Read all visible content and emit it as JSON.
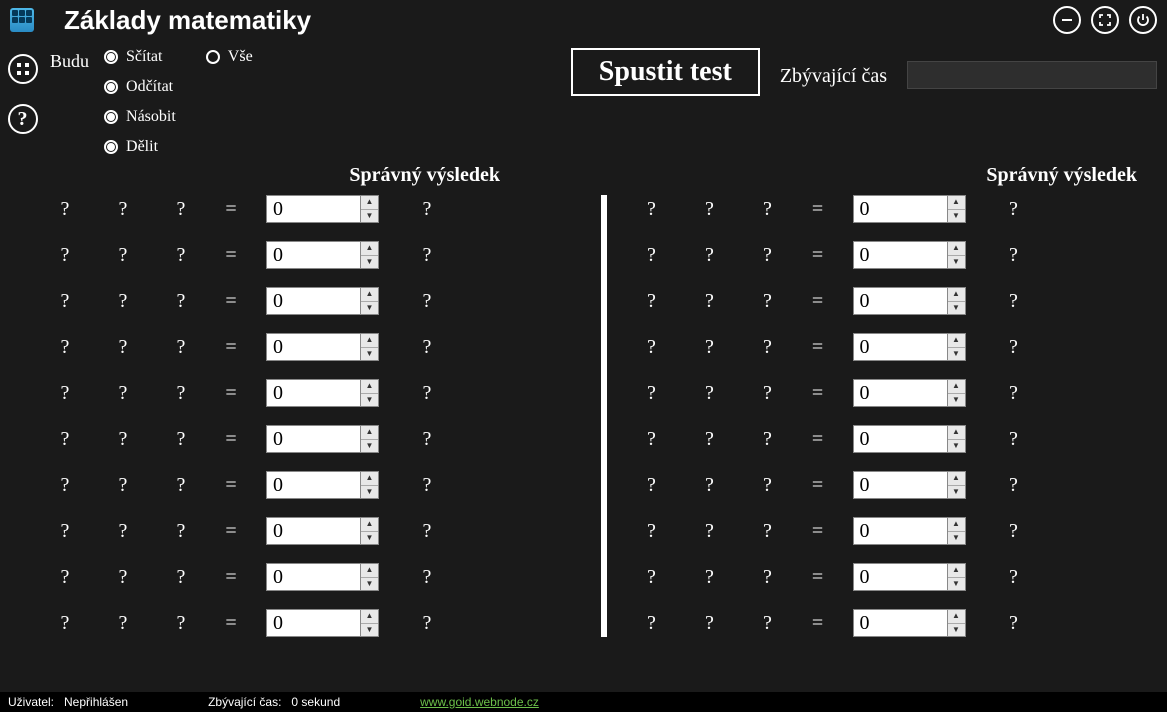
{
  "app": {
    "title": "Základy matematiky"
  },
  "controls": {
    "budu_label": "Budu",
    "radios_col1": [
      "Sčítat",
      "Odčítat",
      "Násobit",
      "Dělit"
    ],
    "radios_col2": [
      "Vše"
    ],
    "start_label": "Spustit test",
    "time_label": "Zbývající čas",
    "result_header": "Správný výsledek"
  },
  "placeholders": {
    "q": "?",
    "eq": "=",
    "spinner_value": "0"
  },
  "status": {
    "user_label": "Uživatel:",
    "user_value": "Nepřihlášen",
    "time_label": "Zbývající čas:",
    "time_value": "0 sekund",
    "link": "www.goid.webnode.cz"
  }
}
